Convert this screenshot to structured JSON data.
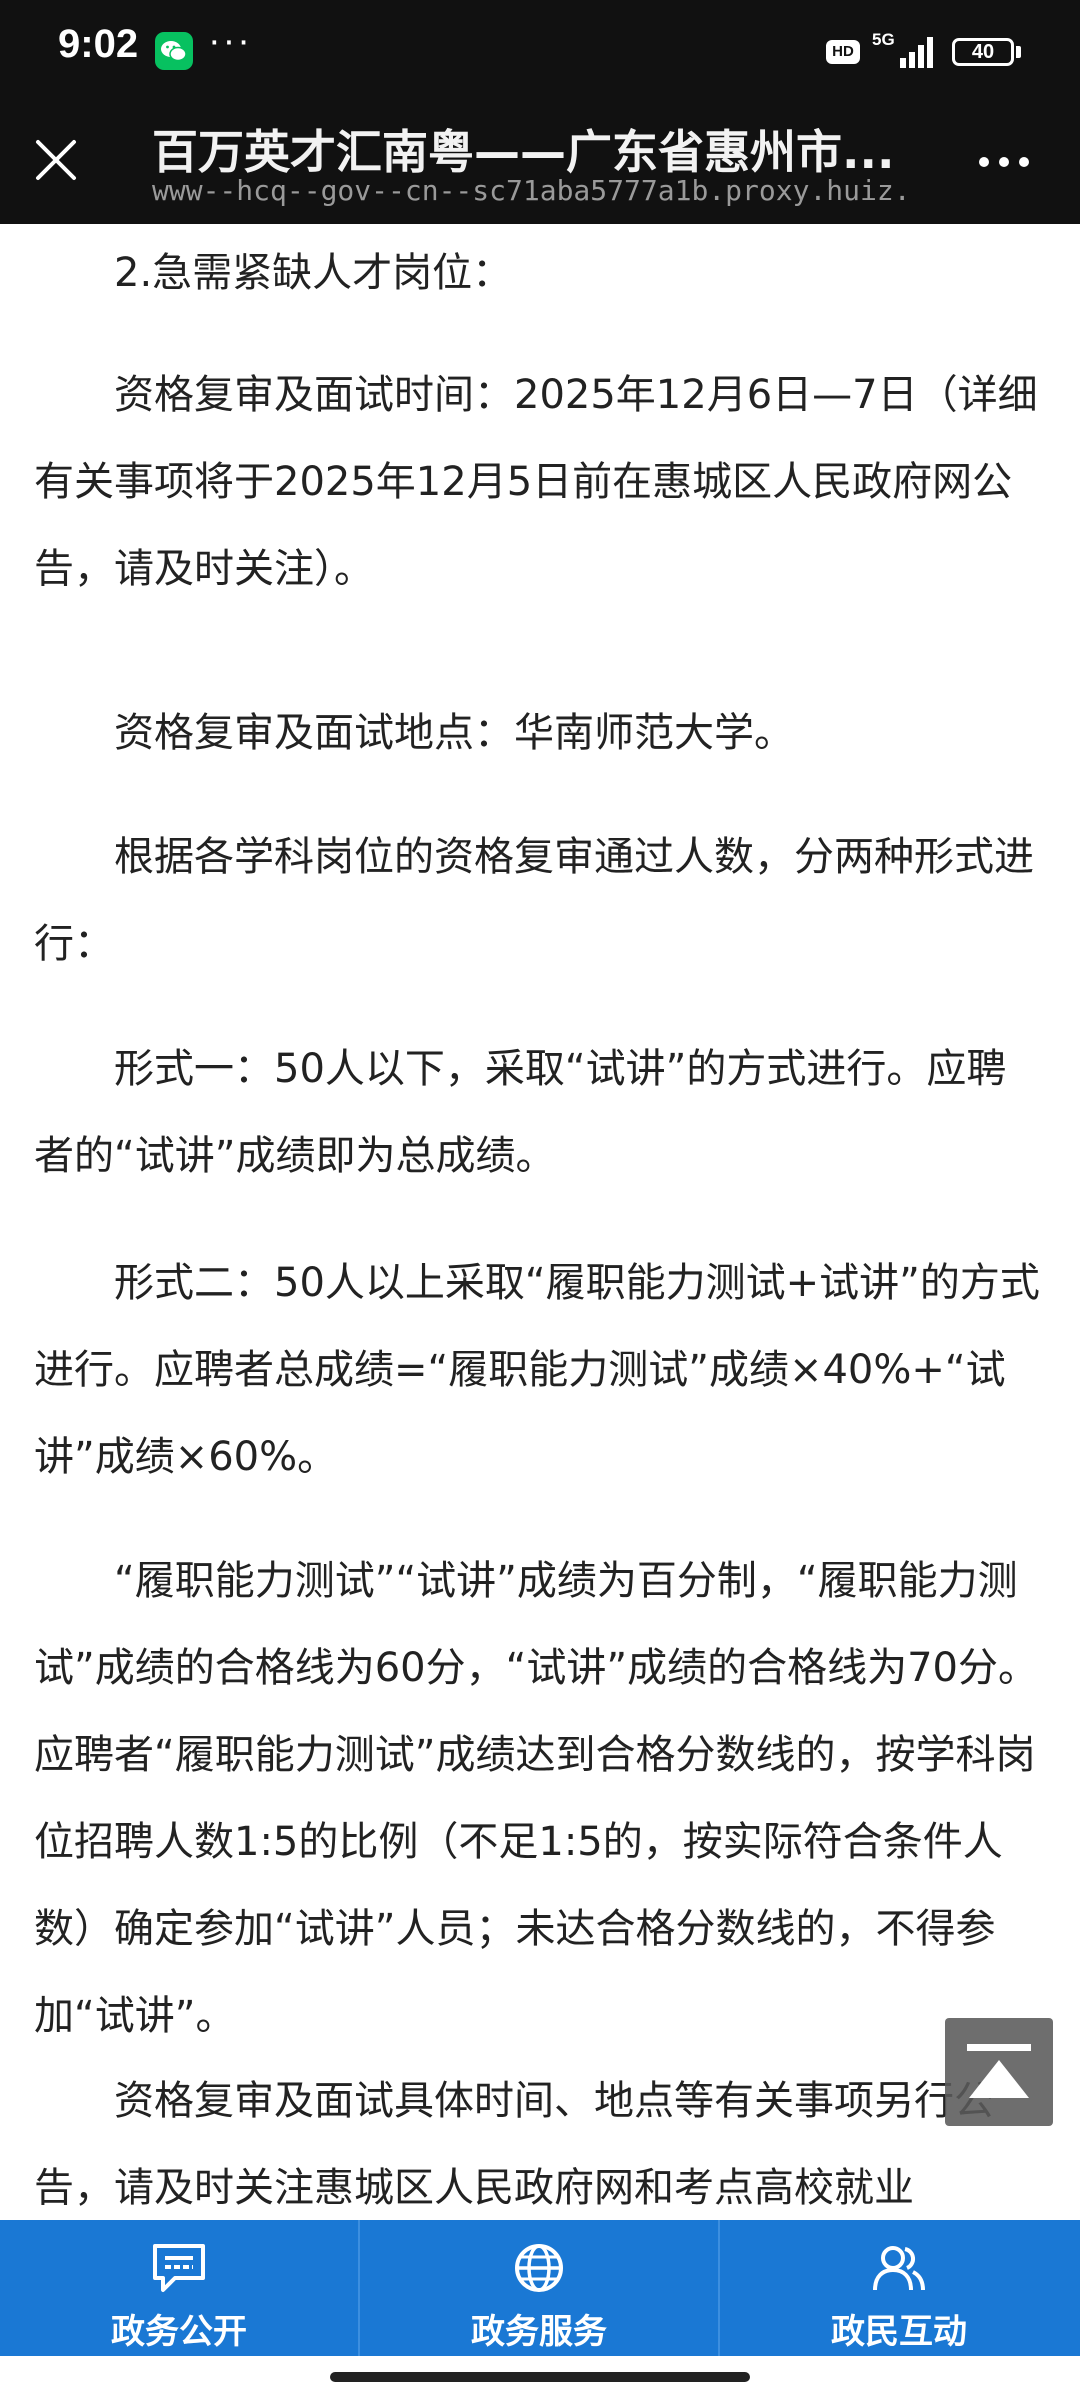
{
  "status_bar": {
    "time": "9:02",
    "dots": "···",
    "hd": "HD",
    "network": "5G",
    "battery": "40"
  },
  "nav": {
    "title": "百万英才汇南粤——广东省惠州市...",
    "url": "www--hcq--gov--cn--sc71aba5777a1b.proxy.huiz..."
  },
  "content": {
    "paragraphs": [
      "2.急需紧缺人才岗位：",
      "资格复审及面试时间：2025年12月6日—7日（详细有关事项将于2025年12月5日前在惠城区人民政府网公告，请及时关注）。",
      "资格复审及面试地点：华南师范大学。",
      "根据各学科岗位的资格复审通过人数，分两种形式进行：",
      "形式一：50人以下，采取“试讲”的方式进行。应聘者的“试讲”成绩即为总成绩。",
      "形式二：50人以上采取“履职能力测试+试讲”的方式进行。应聘者总成绩=“履职能力测试”成绩×40%+“试讲”成绩×60%。",
      "“履职能力测试”“试讲”成绩为百分制，“履职能力测试”成绩的合格线为60分，“试讲”成绩的合格线为70分。应聘者“履职能力测试”成绩达到合格分数线的，按学科岗位招聘人数1:5的比例（不足1:5的，按实际符合条件人数）确定参加“试讲”人员；未达合格分数线的，不得参加“试讲”。",
      "资格复审及面试具体时间、地点等有关事项另行公告，请及时关注惠城区人民政府网和考点高校就业"
    ]
  },
  "tabbar": {
    "tabs": [
      {
        "label": "政务公开",
        "icon": "message-board-icon"
      },
      {
        "label": "政务服务",
        "icon": "globe-icon"
      },
      {
        "label": "政民互动",
        "icon": "users-icon"
      }
    ]
  },
  "colors": {
    "tabbar": "#1a78d4",
    "header": "#111111",
    "text": "#222222"
  }
}
